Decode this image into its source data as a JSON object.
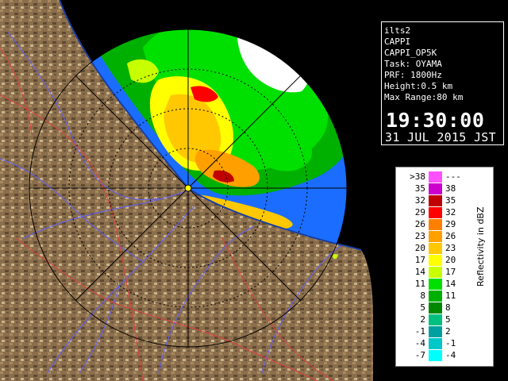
{
  "info": {
    "lines": [
      "ilts2",
      "CAPPI",
      "CAPPI_OP5K",
      "Task: OYAMA",
      "PRF: 1800Hz",
      "Height:0.5 km",
      "Max Range:80 km"
    ],
    "time": "19:30:00",
    "date": "31 JUL 2015 JST"
  },
  "legend": {
    "title": "Reflectivity in dBZ",
    "rows": [
      {
        "low": ">38",
        "high": "---",
        "color": "#ff50ff"
      },
      {
        "low": "35",
        "high": "38",
        "color": "#cc00cc"
      },
      {
        "low": "32",
        "high": "35",
        "color": "#c00000"
      },
      {
        "low": "29",
        "high": "32",
        "color": "#ff0000"
      },
      {
        "low": "26",
        "high": "29",
        "color": "#ff8000"
      },
      {
        "low": "23",
        "high": "26",
        "color": "#ffa000"
      },
      {
        "low": "20",
        "high": "23",
        "color": "#ffc800"
      },
      {
        "low": "17",
        "high": "20",
        "color": "#ffff00"
      },
      {
        "low": "14",
        "high": "17",
        "color": "#c8ff00"
      },
      {
        "low": "11",
        "high": "14",
        "color": "#00e000"
      },
      {
        "low": "8",
        "high": "11",
        "color": "#00b000"
      },
      {
        "low": "5",
        "high": "8",
        "color": "#008800"
      },
      {
        "low": "2",
        "high": "5",
        "color": "#00c080"
      },
      {
        "low": "-1",
        "high": "2",
        "color": "#00a0a0"
      },
      {
        "low": "-4",
        "high": "-1",
        "color": "#00c8c8"
      },
      {
        "low": "-7",
        "high": "-4",
        "color": "#00ffff"
      }
    ]
  },
  "colors": {
    "radar_range": "#1a6dff",
    "terrain": "#8a6d4a",
    "rivers": "#6060ff",
    "borders": "#e04040"
  }
}
